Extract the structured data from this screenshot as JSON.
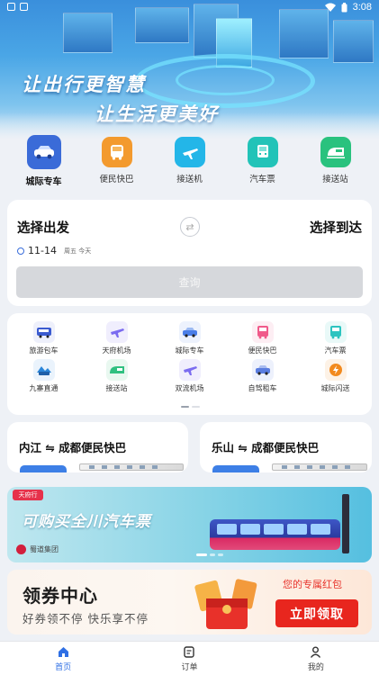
{
  "status_bar": {
    "time": "3:08",
    "icons": [
      "notification-icon",
      "app-icon",
      "wifi-icon",
      "battery-icon"
    ]
  },
  "hero": {
    "slogan_line1": "让出行更智慧",
    "slogan_line2": "让生活更美好"
  },
  "categories": [
    {
      "label": "城际专车",
      "icon": "car-icon",
      "color": "#3a6bd8",
      "active": true
    },
    {
      "label": "便民快巴",
      "icon": "bus-icon",
      "color": "#f39a2e",
      "active": false
    },
    {
      "label": "接送机",
      "icon": "plane-icon",
      "color": "#23b6e8",
      "active": false
    },
    {
      "label": "汽车票",
      "icon": "coach-icon",
      "color": "#22c3b8",
      "active": false
    },
    {
      "label": "接送站",
      "icon": "train-icon",
      "color": "#29c27e",
      "active": false
    }
  ],
  "booking": {
    "from_label": "选择出发",
    "to_label": "选择到达",
    "date": "11-14",
    "weekday": "周五 今天",
    "query_button": "查询"
  },
  "services": [
    {
      "label": "旅游包车",
      "icon": "tour-bus-icon",
      "color": "#3b5bd0"
    },
    {
      "label": "天府机场",
      "icon": "airport-icon",
      "color": "#7b6cf0"
    },
    {
      "label": "城际专车",
      "icon": "car-icon",
      "color": "#4a7ee8"
    },
    {
      "label": "便民快巴",
      "icon": "bus-icon",
      "color": "#f05a8a"
    },
    {
      "label": "汽车票",
      "icon": "coach-icon",
      "color": "#2cc4c0"
    },
    {
      "label": "九寨直通",
      "icon": "mountain-bus-icon",
      "color": "#2b86d9"
    },
    {
      "label": "接送站",
      "icon": "train-icon",
      "color": "#30c080"
    },
    {
      "label": "双流机场",
      "icon": "airport-icon",
      "color": "#7b6cf0"
    },
    {
      "label": "自驾租车",
      "icon": "rental-car-icon",
      "color": "#5a7de0"
    },
    {
      "label": "城际闪送",
      "icon": "delivery-icon",
      "color": "#f28a1e"
    }
  ],
  "routes": [
    {
      "title": "内江 ⇋ 成都便民快巴"
    },
    {
      "title": "乐山 ⇋ 成都便民快巴"
    }
  ],
  "ad_banner": {
    "logo_text": "天府行",
    "headline": "可购买全川汽车票",
    "brand": "蜀道集团"
  },
  "coupon": {
    "title": "领券中心",
    "subtitle": "好券领不停  快乐享不停",
    "exclusive": "您的专属红包",
    "claim_button": "立即领取"
  },
  "bottom_nav": [
    {
      "label": "首页",
      "icon": "home-icon",
      "active": true
    },
    {
      "label": "订单",
      "icon": "order-icon",
      "active": false
    },
    {
      "label": "我的",
      "icon": "profile-icon",
      "active": false
    }
  ],
  "colors": {
    "accent": "#2f6fe4",
    "red": "#e8261e"
  }
}
